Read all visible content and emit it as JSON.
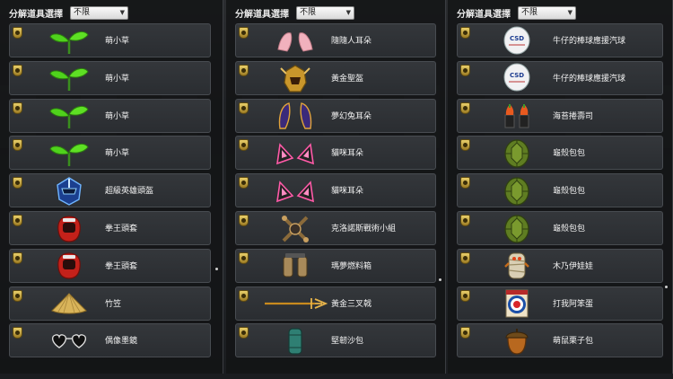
{
  "filter_label": "分解道具選擇",
  "filter_value": "不限",
  "columns": [
    [
      {
        "name": "萌小草",
        "icon": "sprout-icon"
      },
      {
        "name": "萌小草",
        "icon": "sprout-icon"
      },
      {
        "name": "萌小草",
        "icon": "sprout-icon"
      },
      {
        "name": "萌小草",
        "icon": "sprout-icon"
      },
      {
        "name": "超級英雄頭盔",
        "icon": "hero-helmet-icon"
      },
      {
        "name": "拳王頭套",
        "icon": "boxing-headgear-icon"
      },
      {
        "name": "拳王頭套",
        "icon": "boxing-headgear-icon"
      },
      {
        "name": "竹笠",
        "icon": "bamboo-hat-icon"
      },
      {
        "name": "偶像墨鏡",
        "icon": "heart-sunglasses-icon"
      }
    ],
    [
      {
        "name": "隨隨人耳朵",
        "icon": "pink-ears-icon"
      },
      {
        "name": "黃金聖盔",
        "icon": "golden-helmet-icon"
      },
      {
        "name": "夢幻兔耳朵",
        "icon": "rabbit-ears-icon"
      },
      {
        "name": "貓咪耳朵",
        "icon": "cat-ears-icon"
      },
      {
        "name": "貓咪耳朵",
        "icon": "cat-ears-icon"
      },
      {
        "name": "克洛諾斯戰術小組",
        "icon": "tactical-emblem-icon"
      },
      {
        "name": "瑪夢燃料箱",
        "icon": "fuel-tank-icon"
      },
      {
        "name": "黃金三叉戟",
        "icon": "golden-trident-icon"
      },
      {
        "name": "堅韌沙包",
        "icon": "sandbag-icon"
      }
    ],
    [
      {
        "name": "牛仔的棒球應援汽球",
        "icon": "csd-balloon-icon"
      },
      {
        "name": "牛仔的棒球應援汽球",
        "icon": "csd-balloon-icon"
      },
      {
        "name": "海苔捲壽司",
        "icon": "sushi-icon"
      },
      {
        "name": "龜殼包包",
        "icon": "turtle-shell-icon"
      },
      {
        "name": "龜殼包包",
        "icon": "turtle-shell-icon"
      },
      {
        "name": "龜殼包包",
        "icon": "turtle-shell-icon"
      },
      {
        "name": "木乃伊娃娃",
        "icon": "mummy-doll-icon"
      },
      {
        "name": "打我阿笨蛋",
        "icon": "target-board-icon"
      },
      {
        "name": "萌鼠栗子包",
        "icon": "acorn-bag-icon"
      }
    ]
  ],
  "balloon_text": "CSD"
}
